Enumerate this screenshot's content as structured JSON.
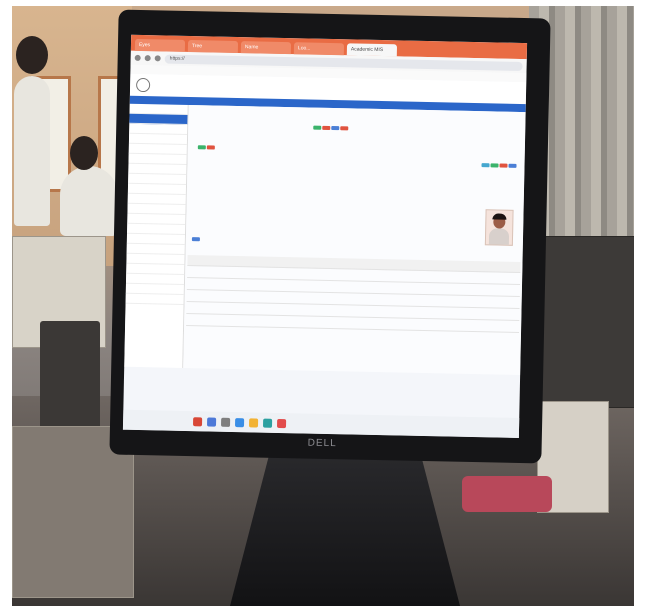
{
  "photo": {
    "description_hidden": "",
    "monitor_brand": "DELL"
  },
  "browser": {
    "tabs": [
      {
        "label": "Eyes"
      },
      {
        "label": "Tree"
      },
      {
        "label": "Name"
      },
      {
        "label": "Loo..."
      },
      {
        "label": "Academic MIS"
      }
    ],
    "url": "https://"
  },
  "site": {
    "top_bar_label": "",
    "right_label": ""
  },
  "sidebar": {
    "items": [
      "",
      "",
      "",
      "",
      "",
      "",
      "",
      "",
      "",
      "",
      "",
      "",
      "",
      "",
      "",
      "",
      "",
      "",
      "",
      ""
    ]
  },
  "colors": {
    "tabbar": "#e96c44",
    "accent_blue": "#2b66c9",
    "green_button": "#3bb36b",
    "red_button": "#e0533f"
  }
}
